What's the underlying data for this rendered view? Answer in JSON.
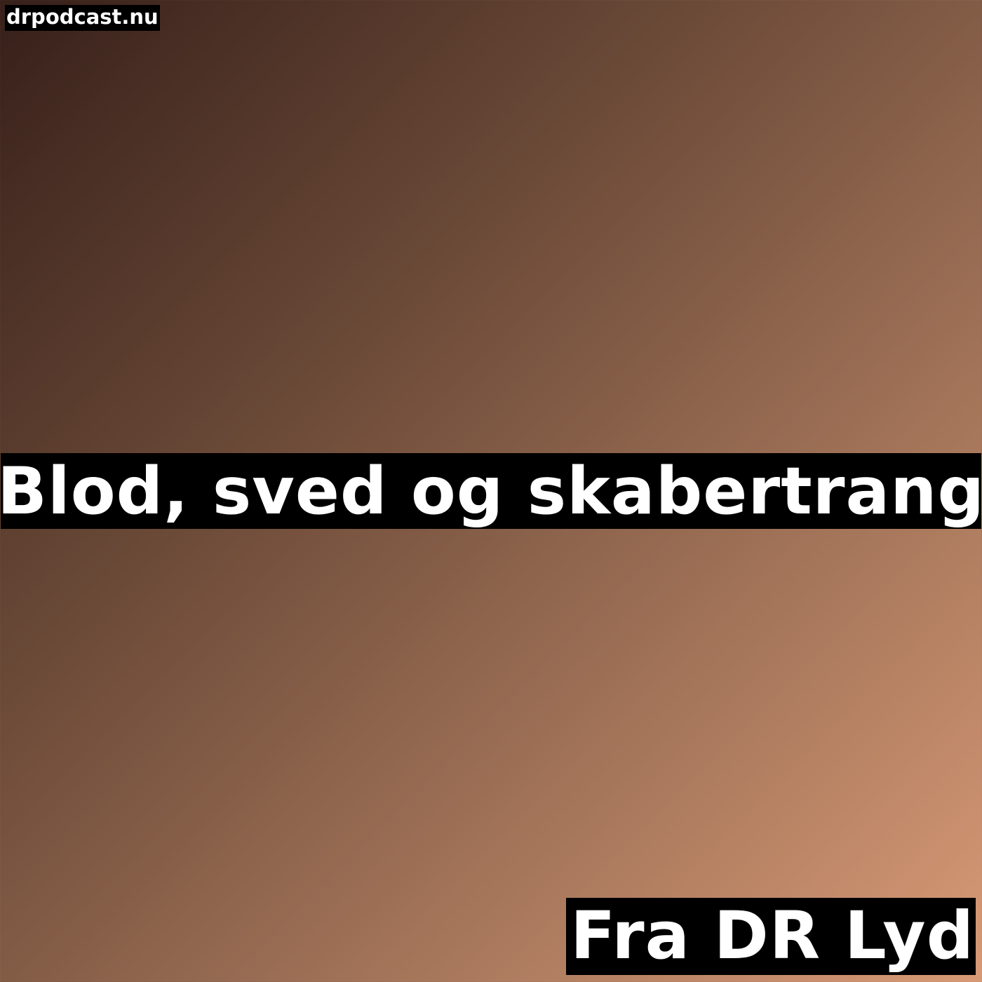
{
  "site_label": "drpodcast.nu",
  "title": "Blod, sved og skabertrang",
  "source": "Fra DR Lyd",
  "colors": {
    "gradient_dark": "#37201a",
    "gradient_mid": "#9c6f55",
    "gradient_light": "#d89a76",
    "label_background": "#000000",
    "label_text": "#ffffff"
  }
}
